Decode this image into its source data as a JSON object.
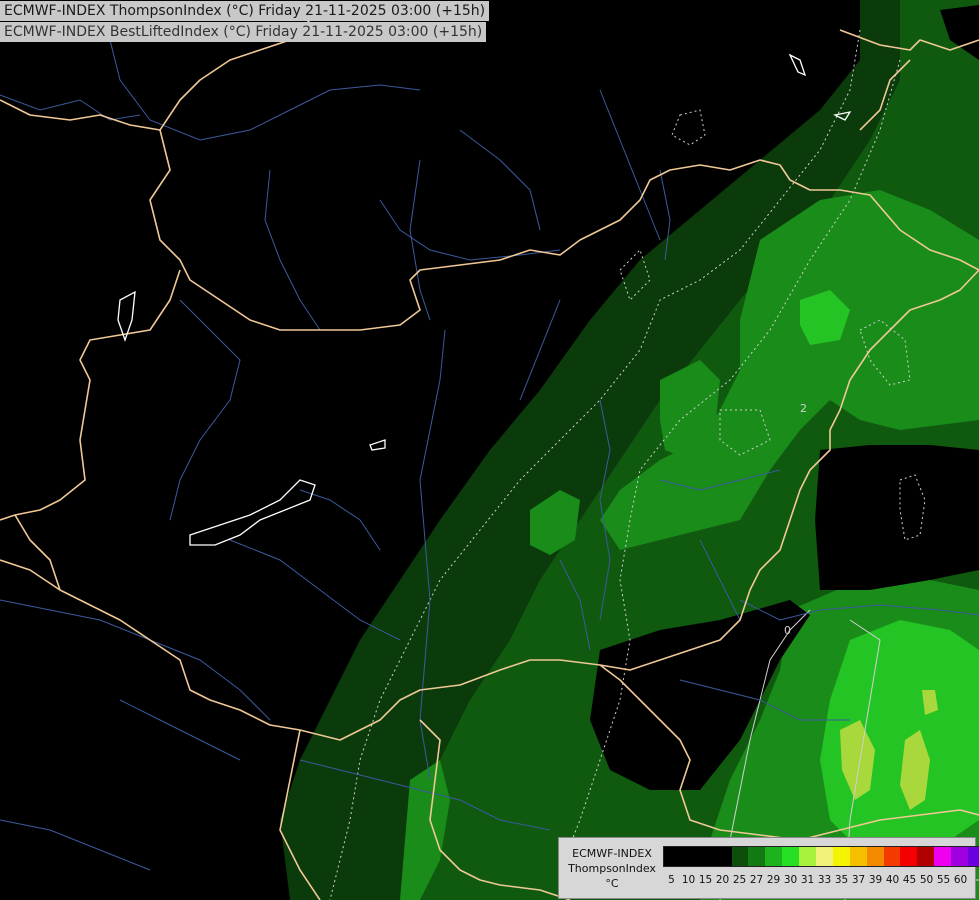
{
  "title_line1": "ECMWF-INDEX ThompsonIndex (°C) Friday 21-11-2025 03:00 (+15h)",
  "title_line2": "ECMWF-INDEX BestLiftedIndex (°C) Friday 21-11-2025 03:00 (+15h)",
  "legend": {
    "line1": "ECMWF-INDEX",
    "line2": "ThompsonIndex",
    "line3": "°C",
    "ticks": [
      "5",
      "10",
      "15",
      "20",
      "25",
      "27",
      "29",
      "30",
      "31",
      "33",
      "35",
      "37",
      "39",
      "40",
      "45",
      "50",
      "55",
      "60"
    ],
    "colors": [
      "#000000",
      "#000000",
      "#000000",
      "#000000",
      "#0b4f0b",
      "#137a13",
      "#1fb21f",
      "#25e025",
      "#a8f23c",
      "#f2f27a",
      "#f4f400",
      "#f5c000",
      "#f58a00",
      "#f53a00",
      "#f50000",
      "#b00000",
      "#f000f0",
      "#a000e0",
      "#6a00e0",
      "#0000f0"
    ]
  },
  "contour_labels": [
    {
      "text": "2"
    },
    {
      "text": "0"
    }
  ],
  "colors": {
    "background": "#000000",
    "border": "#f0c896",
    "river": "#3c5a9c",
    "contour": "#d0d0d0",
    "lake": "#ffffff"
  }
}
